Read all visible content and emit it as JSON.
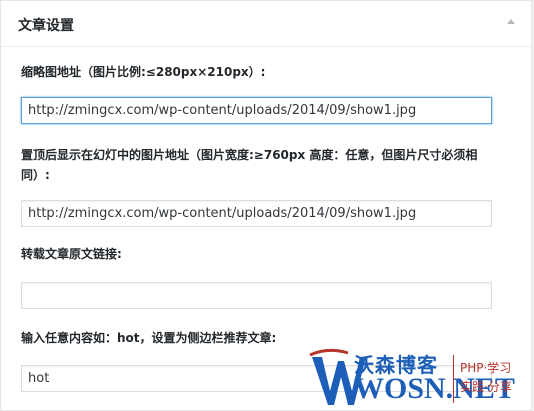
{
  "metabox": {
    "title": "文章设置",
    "collapse_icon": "triangle-up-icon"
  },
  "fields": [
    {
      "label": "缩略图地址（图片比例:≤280px×210px）:",
      "value": "http://zmingcx.com/wp-content/uploads/2014/09/show1.jpg",
      "focused": true
    },
    {
      "label": "置顶后显示在幻灯中的图片地址（图片宽度:≥760px 高度：任意，但图片尺寸必须相同）:",
      "value": "http://zmingcx.com/wp-content/uploads/2014/09/show1.jpg",
      "focused": false
    },
    {
      "label": "转载文章原文链接:",
      "value": "",
      "focused": false
    },
    {
      "label": "输入任意内容如：hot，设置为侧边栏推荐文章:",
      "value": "hot",
      "focused": false
    }
  ],
  "watermark": {
    "cn": "沃森博客",
    "en": "WOSN.NET",
    "tag1": "PHP·学习",
    "tag2": "实践·分享"
  },
  "colors": {
    "accent": "#5b9dd9",
    "watermark_blue": "#1d5fb8",
    "watermark_red": "#b7342b"
  }
}
